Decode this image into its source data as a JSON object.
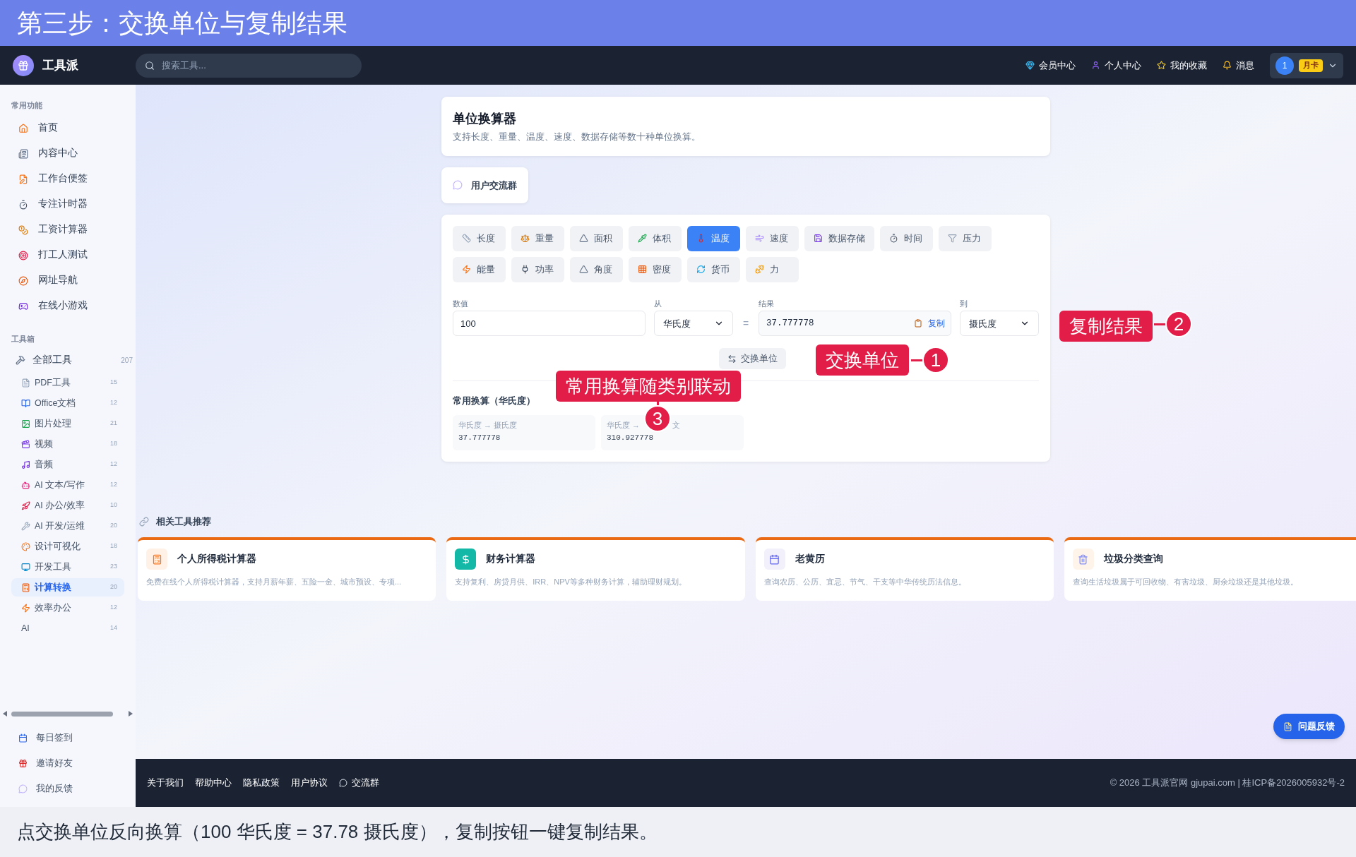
{
  "banner": {
    "title": "第三步：交换单位与复制结果"
  },
  "navbar": {
    "logo_text": "工具派",
    "search": {
      "placeholder": "搜索工具..."
    },
    "links": [
      "会员中心",
      "个人中心",
      "我的收藏",
      "消息"
    ],
    "user": {
      "avatar": "1",
      "badge": "月卡"
    }
  },
  "sidebar": {
    "sections": [
      {
        "title": "常用功能",
        "items": [
          {
            "label": "首页",
            "selected": false
          },
          {
            "label": "内容中心",
            "selected": false
          },
          {
            "label": "工作台便签",
            "selected": false
          },
          {
            "label": "专注计时器",
            "selected": false
          },
          {
            "label": "工资计算器",
            "selected": false
          },
          {
            "label": "打工人测试",
            "selected": false
          },
          {
            "label": "网址导航",
            "selected": false
          },
          {
            "label": "在线小游戏",
            "selected": false
          }
        ]
      },
      {
        "title": "工具箱",
        "items": [
          {
            "label": "全部工具",
            "count": "207",
            "selected": false,
            "children": [
              {
                "label": "PDF工具",
                "count": "15",
                "selected": false
              },
              {
                "label": "Office文档",
                "count": "12",
                "selected": false
              },
              {
                "label": "图片处理",
                "count": "21",
                "selected": false
              },
              {
                "label": "视频",
                "count": "18",
                "selected": false
              },
              {
                "label": "音频",
                "count": "12",
                "selected": false
              },
              {
                "label": "AI 文本/写作",
                "count": "12",
                "selected": false
              },
              {
                "label": "AI 办公/效率",
                "count": "10",
                "selected": false
              },
              {
                "label": "AI 开发/运维",
                "count": "20",
                "selected": false
              },
              {
                "label": "设计可视化",
                "count": "18",
                "selected": false
              },
              {
                "label": "开发工具",
                "count": "23",
                "selected": false
              },
              {
                "label": "计算转换",
                "count": "20",
                "selected": true
              },
              {
                "label": "效率办公",
                "count": "12",
                "selected": false
              },
              {
                "label": "AI",
                "count": "14",
                "selected": false
              }
            ]
          }
        ]
      }
    ],
    "bottom_items": [
      {
        "label": "每日签到"
      },
      {
        "label": "邀请好友"
      },
      {
        "label": "我的反馈"
      }
    ]
  },
  "tool_header": {
    "title": "单位换算器",
    "description": "支持长度、重量、温度、速度、数据存储等数十种单位换算。"
  },
  "community_button": "用户交流群",
  "converter": {
    "categories": [
      {
        "label": "长度",
        "selected": false
      },
      {
        "label": "重量",
        "selected": false
      },
      {
        "label": "面积",
        "selected": false
      },
      {
        "label": "体积",
        "selected": false
      },
      {
        "label": "温度",
        "selected": true
      },
      {
        "label": "速度",
        "selected": false
      },
      {
        "label": "数据存储",
        "selected": false
      },
      {
        "label": "时间",
        "selected": false
      },
      {
        "label": "压力",
        "selected": false
      },
      {
        "label": "能量",
        "selected": false
      },
      {
        "label": "功率",
        "selected": false
      },
      {
        "label": "角度",
        "selected": false
      },
      {
        "label": "密度",
        "selected": false
      },
      {
        "label": "货币",
        "selected": false
      },
      {
        "label": "力",
        "selected": false
      }
    ],
    "value": {
      "label": "数值",
      "value": "100"
    },
    "from": {
      "label": "从",
      "value": "华氏度"
    },
    "equals": "=",
    "result": {
      "label": "结果",
      "value": "37.777778",
      "copy": "复制"
    },
    "to": {
      "label": "到",
      "value": "摄氏度"
    },
    "swap_button": "交换单位",
    "common": {
      "title": "常用换算（华氏度）",
      "items": [
        {
          "label": "华氏度 → 摄氏度",
          "value": "37.777778"
        },
        {
          "label": "华氏度 →",
          "label_end": "文",
          "value": "310.927778"
        }
      ]
    }
  },
  "related": {
    "title": "相关工具推荐",
    "cards": [
      {
        "title": "个人所得税计算器",
        "description": "免费在线个人所得税计算器，支持月薪年薪、五险一金、城市预设、专项..."
      },
      {
        "title": "财务计算器",
        "description": "支持复利、房贷月供、IRR、NPV等多种财务计算，辅助理财规划。"
      },
      {
        "title": "老黄历",
        "description": "查询农历、公历、宜忌、节气、干支等中华传统历法信息。"
      },
      {
        "title": "垃圾分类查询",
        "description": "查询生活垃圾属于可回收物、有害垃圾、厨余垃圾还是其他垃圾。"
      }
    ]
  },
  "feedback_button": "问题反馈",
  "footer": {
    "links": [
      "关于我们",
      "帮助中心",
      "隐私政策",
      "用户协议",
      "交流群"
    ],
    "copyright": "© 2026 工具派官网 gjupai.com | 桂ICP备2026005932号-2"
  },
  "annotations": [
    {
      "number": "1",
      "text": "交换单位"
    },
    {
      "number": "2",
      "text": "复制结果"
    },
    {
      "number": "3",
      "text": "常用换算随类别联动"
    }
  ],
  "caption": "点交换单位反向换算（100 华氏度 = 37.78 摄氏度），复制按钮一键复制结果。"
}
